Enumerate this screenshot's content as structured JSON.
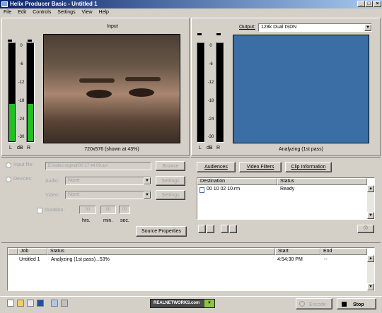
{
  "window": {
    "title": "Helix Producer Basic - Untitled 1",
    "min": "_",
    "max": "□",
    "close": "×"
  },
  "menu": [
    "File",
    "Edit",
    "Controls",
    "Settings",
    "View",
    "Help"
  ],
  "meter_scale": [
    "0",
    "-6",
    "-12",
    "-18",
    "-24",
    "-30"
  ],
  "meter_labels": {
    "l": "L",
    "db": "dB",
    "r": "R"
  },
  "input_panel": {
    "title": "Input",
    "caption": "720x576 (shown at 43%)",
    "left_level": 0.38,
    "right_level": 0.38
  },
  "output_panel": {
    "output_label": "Output:",
    "output_value": "128k Dual ISDN",
    "status": "Analyzing (1st pass)",
    "preview_color": "#3a6ea5"
  },
  "source": {
    "input_file_label": "Input file:",
    "input_file_value": "E:\\video orginal\\00 17 44 09.avi",
    "browse": "Browse",
    "devices_label": "Devices:",
    "audio_label": "Audio:",
    "audio_value": "None",
    "video_label": "Video:",
    "video_value": "None",
    "settings": "Settings",
    "duration_label": "Duration:",
    "duration_values": [
      "00",
      "00",
      "00"
    ],
    "hrs": "hrs.",
    "min": "min.",
    "sec": "sec.",
    "source_properties": "Source Properties"
  },
  "dest": {
    "audiences": "Audiences",
    "video_filters": "Video Filters",
    "clip_information": "Clip Information",
    "col_destination": "Destination",
    "col_status": "Status",
    "rows": [
      {
        "destination": "00 10 02 10.rm",
        "status": "Ready"
      }
    ]
  },
  "jobs": {
    "col_job": "Job",
    "col_status": "Status",
    "col_start": "Start",
    "col_end": "End",
    "rows": [
      {
        "job": "Untitled 1",
        "status": "Analyzing (1st pass)...53%",
        "start": "4:54:30 PM",
        "end": "--"
      }
    ]
  },
  "bottom": {
    "brand": "REALNETWORKS.com",
    "encode": "Encode",
    "stop": "Stop"
  }
}
